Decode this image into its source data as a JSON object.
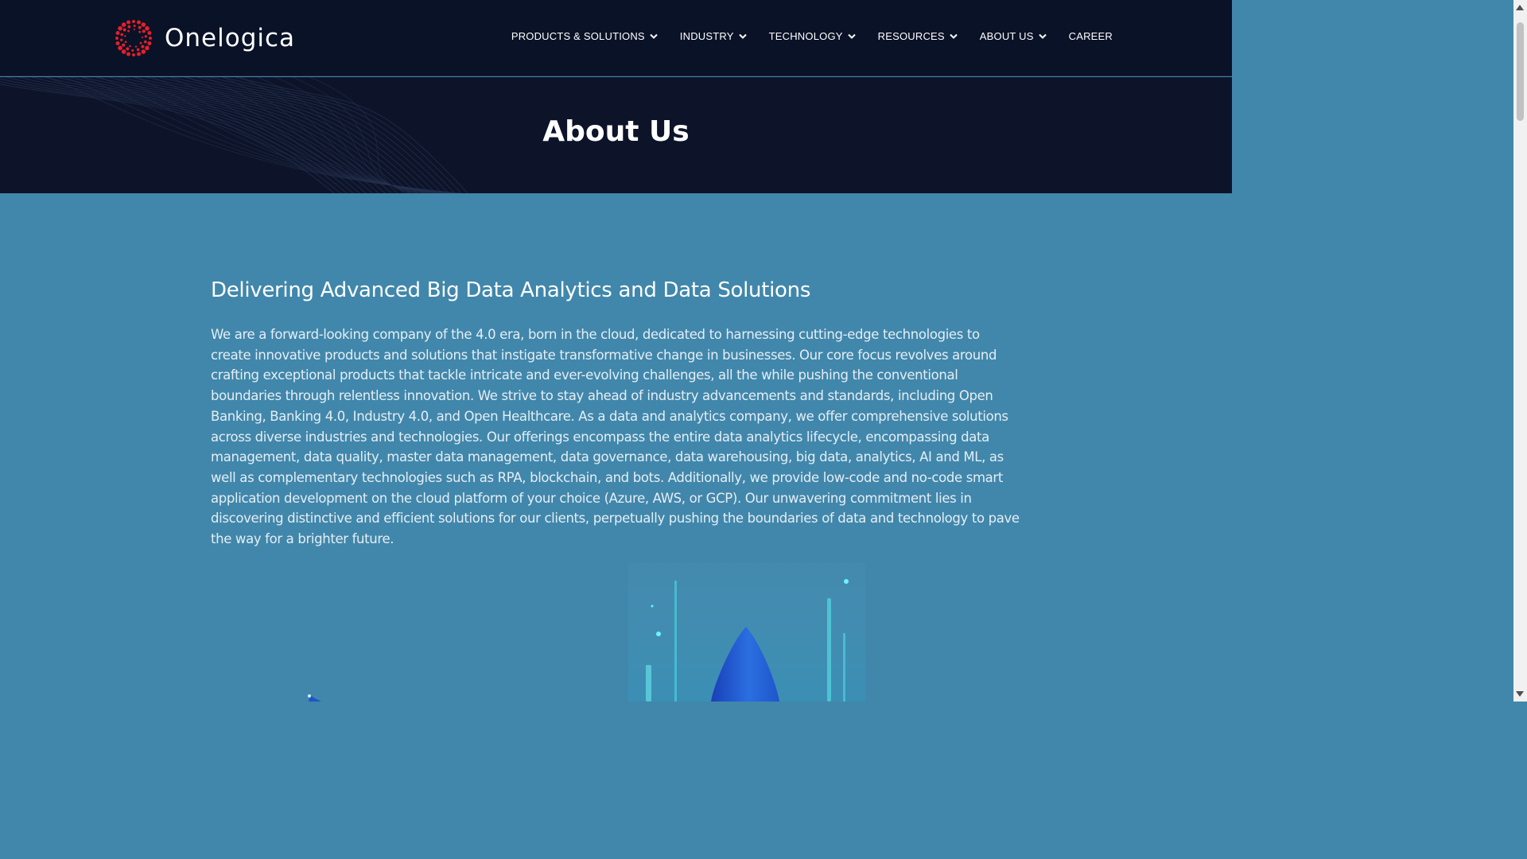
{
  "brand": {
    "name": "Onelogica",
    "logo_icon": "red-dotted-circle-logo",
    "accent_color": "#e2202b"
  },
  "nav": {
    "items": [
      {
        "label": "PRODUCTS & SOLUTIONS",
        "has_dropdown": true
      },
      {
        "label": "INDUSTRY",
        "has_dropdown": true
      },
      {
        "label": "TECHNOLOGY",
        "has_dropdown": true
      },
      {
        "label": "RESOURCES",
        "has_dropdown": true
      },
      {
        "label": "ABOUT US",
        "has_dropdown": true
      },
      {
        "label": "CAREER",
        "has_dropdown": false
      }
    ]
  },
  "banner": {
    "title": "About Us"
  },
  "content": {
    "heading": "Delivering Advanced Big Data Analytics and Data Solutions",
    "paragraph": "We are a forward-looking company of the 4.0 era, born in the cloud, dedicated to harnessing cutting-edge technologies to create innovative products and solutions that instigate transformative change in businesses. Our core focus revolves around crafting exceptional products that tackle intricate and ever-evolving challenges, all the while pushing the conventional boundaries through relentless innovation. We strive to stay ahead of industry advancements and standards, including Open Banking, Banking 4.0, Industry 4.0, and Open Healthcare. As a data and analytics company, we offer comprehensive solutions across diverse industries and technologies. Our offerings encompass the entire data analytics lifecycle, encompassing data management, data quality, master data management, data governance, data warehousing, big data, analytics, AI and ML, as well as complementary technologies such as RPA, blockchain, and bots. Additionally, we provide low-code and no-code smart application development on the cloud platform of your choice (Azure, AWS, or GCP). Our unwavering commitment lies in discovering distinctive and efficient solutions for our clients, perpetually pushing the boundaries of data and technology to pave the way for a brighter future."
  },
  "colors": {
    "header_bg": "#0a1227",
    "banner_bg": "#0d1429",
    "content_bg": "#4187ab"
  }
}
